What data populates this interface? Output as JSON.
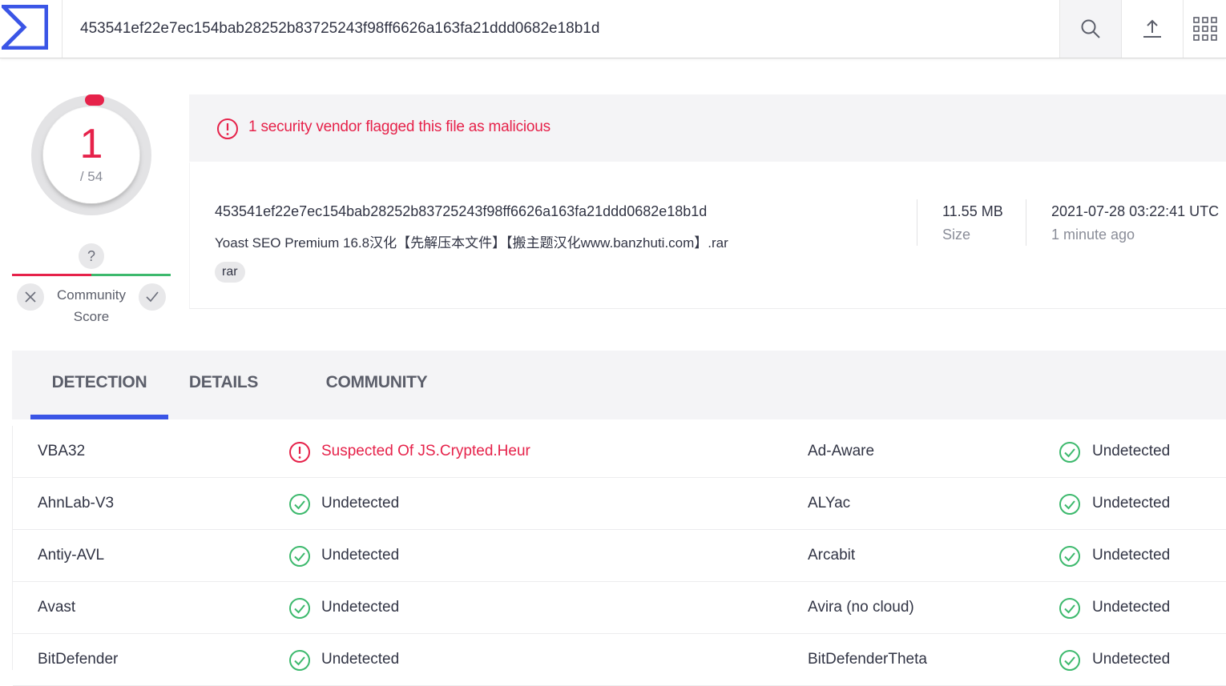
{
  "search": {
    "query": "453541ef22e7ec154bab28252b83725243f98ff6626a163fa21ddd0682e18b1d"
  },
  "toolbar": {
    "icons": [
      "search-icon",
      "upload-icon",
      "apps-grid-icon"
    ]
  },
  "colors": {
    "malicious": "#e6224a",
    "clean": "#3db96d",
    "accent": "#3a55e6"
  },
  "score": {
    "detections": "1",
    "total": "/ 54",
    "community_help": "?",
    "community_label_1": "Community",
    "community_label_2": "Score"
  },
  "alert": {
    "text": "1 security vendor flagged this file as malicious"
  },
  "file": {
    "hash": "453541ef22e7ec154bab28252b83725243f98ff6626a163fa21ddd0682e18b1d",
    "name": "Yoast SEO Premium 16.8汉化【先解压本文件】【搬主题汉化www.banzhuti.com】.rar",
    "tag": "rar",
    "size_value": "11.55 MB",
    "size_label": "Size",
    "date_value": "2021-07-28 03:22:41 UTC",
    "date_label": "1 minute ago"
  },
  "tabs": {
    "detection": "DETECTION",
    "details": "DETAILS",
    "community": "COMMUNITY"
  },
  "detections": [
    {
      "left_engine": "VBA32",
      "left_result": "Suspected Of JS.Crypted.Heur",
      "left_status": "malicious",
      "right_engine": "Ad-Aware",
      "right_result": "Undetected",
      "right_status": "clean"
    },
    {
      "left_engine": "AhnLab-V3",
      "left_result": "Undetected",
      "left_status": "clean",
      "right_engine": "ALYac",
      "right_result": "Undetected",
      "right_status": "clean"
    },
    {
      "left_engine": "Antiy-AVL",
      "left_result": "Undetected",
      "left_status": "clean",
      "right_engine": "Arcabit",
      "right_result": "Undetected",
      "right_status": "clean"
    },
    {
      "left_engine": "Avast",
      "left_result": "Undetected",
      "left_status": "clean",
      "right_engine": "Avira (no cloud)",
      "right_result": "Undetected",
      "right_status": "clean"
    },
    {
      "left_engine": "BitDefender",
      "left_result": "Undetected",
      "left_status": "clean",
      "right_engine": "BitDefenderTheta",
      "right_result": "Undetected",
      "right_status": "clean"
    }
  ]
}
